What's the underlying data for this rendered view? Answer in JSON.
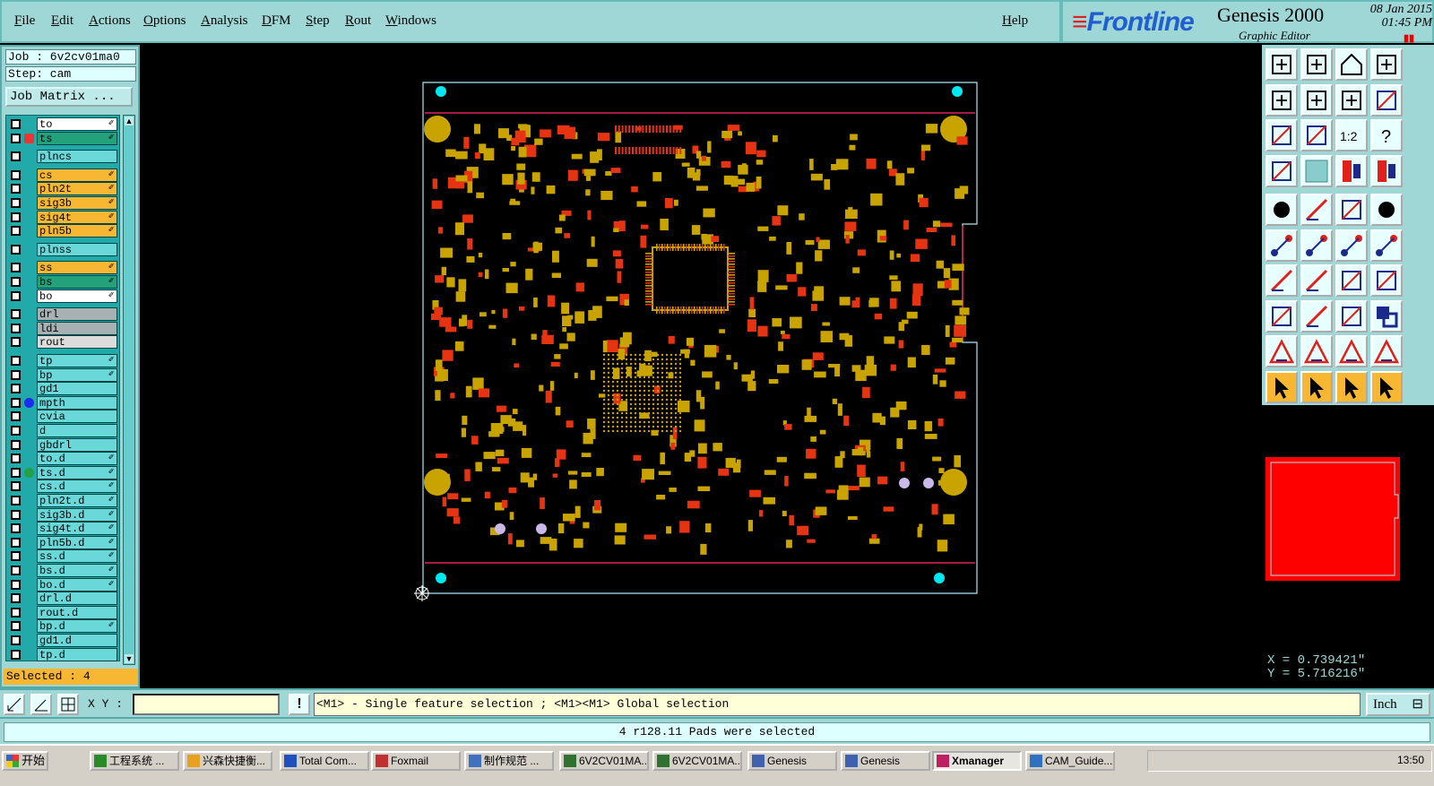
{
  "menu": {
    "items": [
      "File",
      "Edit",
      "Actions",
      "Options",
      "Analysis",
      "DFM",
      "Step",
      "Rout",
      "Windows"
    ],
    "help": "Help"
  },
  "brand": {
    "logo": "Frontline",
    "product": "Genesis 2000",
    "subtitle": "Graphic Editor",
    "date": "08 Jan 2015",
    "time": "01:45 PM"
  },
  "job": {
    "job_line": "Job : 6v2cv01ma0",
    "step_line": "Step: cam",
    "matrix_button": "Job Matrix ..."
  },
  "layers": [
    {
      "name": "to",
      "color": "#ffffff",
      "mark": "✐"
    },
    {
      "name": "ts",
      "color": "#23a17a",
      "mark": "✐",
      "active": true
    },
    {
      "name": "plncs",
      "color": "#6ad8d8",
      "mark": ""
    },
    {
      "name": "cs",
      "color": "#f7b733",
      "mark": "✐"
    },
    {
      "name": "pln2t",
      "color": "#f7b733",
      "mark": "✐"
    },
    {
      "name": "sig3b",
      "color": "#f7b733",
      "mark": "✐"
    },
    {
      "name": "sig4t",
      "color": "#f7b733",
      "mark": "✐"
    },
    {
      "name": "pln5b",
      "color": "#f7b733",
      "mark": "✐"
    },
    {
      "name": "plnss",
      "color": "#6ad8d8",
      "mark": ""
    },
    {
      "name": "ss",
      "color": "#f7b733",
      "mark": "✐"
    },
    {
      "name": "bs",
      "color": "#23a17a",
      "mark": "✐"
    },
    {
      "name": "bo",
      "color": "#ffffff",
      "mark": "✐"
    },
    {
      "name": "drl",
      "color": "#a7b0b3",
      "mark": ""
    },
    {
      "name": "ldi",
      "color": "#a7b0b3",
      "mark": ""
    },
    {
      "name": "rout",
      "color": "#dcdcdc",
      "mark": ""
    },
    {
      "name": "tp",
      "color": "#6ad8d8",
      "mark": "✐"
    },
    {
      "name": "bp",
      "color": "#6ad8d8",
      "mark": "✐"
    },
    {
      "name": "gd1",
      "color": "#6ad8d8",
      "mark": ""
    },
    {
      "name": "mpth",
      "color": "#6ad8d8",
      "mark": "",
      "dot": "#1a2cf0"
    },
    {
      "name": "cvia",
      "color": "#6ad8d8",
      "mark": ""
    },
    {
      "name": "d",
      "color": "#6ad8d8",
      "mark": ""
    },
    {
      "name": "gbdrl",
      "color": "#6ad8d8",
      "mark": ""
    },
    {
      "name": "to.d",
      "color": "#6ad8d8",
      "mark": "✐"
    },
    {
      "name": "ts.d",
      "color": "#6ad8d8",
      "mark": "✐",
      "dot": "#22a043"
    },
    {
      "name": "cs.d",
      "color": "#6ad8d8",
      "mark": "✐"
    },
    {
      "name": "pln2t.d",
      "color": "#6ad8d8",
      "mark": "✐"
    },
    {
      "name": "sig3b.d",
      "color": "#6ad8d8",
      "mark": "✐"
    },
    {
      "name": "sig4t.d",
      "color": "#6ad8d8",
      "mark": "✐"
    },
    {
      "name": "pln5b.d",
      "color": "#6ad8d8",
      "mark": "✐"
    },
    {
      "name": "ss.d",
      "color": "#6ad8d8",
      "mark": "✐"
    },
    {
      "name": "bs.d",
      "color": "#6ad8d8",
      "mark": "✐"
    },
    {
      "name": "bo.d",
      "color": "#6ad8d8",
      "mark": "✐"
    },
    {
      "name": "drl.d",
      "color": "#6ad8d8",
      "mark": ""
    },
    {
      "name": "rout.d",
      "color": "#6ad8d8",
      "mark": ""
    },
    {
      "name": "bp.d",
      "color": "#6ad8d8",
      "mark": "✐"
    },
    {
      "name": "gd1.d",
      "color": "#6ad8d8",
      "mark": ""
    },
    {
      "name": "tp.d",
      "color": "#6ad8d8",
      "mark": ""
    }
  ],
  "selected": "Selected : 4",
  "coords": {
    "x": "X = 0.739421\"",
    "y": "Y = 5.716216\""
  },
  "command": {
    "xy_label": "X Y :",
    "xy_value": "",
    "prompt": "<M1> - Single feature selection ; <M1><M1> Global selection",
    "unit": "Inch"
  },
  "status": "4 r128.11 Pads were selected",
  "taskbar": {
    "start": "开始",
    "tasks": [
      "工程系统 ...",
      "兴森快捷衡...",
      "Total Com...",
      "Foxmail",
      "制作规范 ...",
      "6V2CV01MA...",
      "6V2CV01MA...",
      "Genesis",
      "Genesis",
      "Xmanager",
      "CAM_Guide..."
    ],
    "active_task": 9,
    "clock": "13:50"
  },
  "colors": {
    "panel": "#9fd7d7",
    "pad": "#c9a300",
    "feature_red": "#e63312",
    "outline": "#a8e8f0",
    "route": "#e0225e",
    "selected_pad": "#00e8f0",
    "overview_fill": "#ff0000"
  },
  "toolbar_icons": [
    "zoom-home-icon",
    "zoom-in-icon",
    "home-icon",
    "zoom-window-icon",
    "pan-left-icon",
    "pan-right-icon",
    "zoom-back-icon",
    "redraw-icon",
    "fit-all-icon",
    "fit-profile-icon",
    "scale-1-2-icon",
    "help-query-icon",
    "measure-icon",
    "grid-icon",
    "layers-compare-icon",
    "layers-view-icon",
    "add-pad-icon",
    "add-line-icon",
    "ruler-icon",
    "round-pad-icon",
    "snap-node-icon",
    "snap-center-icon",
    "snap-midpoint-icon",
    "snap-end-icon",
    "line-angle-icon",
    "line-diag-icon",
    "arc-icon",
    "feature-frame-icon",
    "move-icon",
    "line-h-icon",
    "dimension-icon",
    "copy-icon",
    "triangle-1-icon",
    "triangle-2-icon",
    "triangle-3-icon",
    "triangle-4-icon",
    "select-pointer-icon",
    "select-box-icon",
    "select-touch-icon",
    "select-move-icon"
  ]
}
